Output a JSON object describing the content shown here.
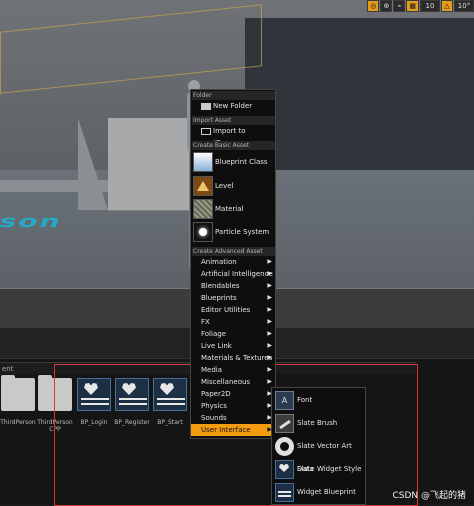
{
  "viewport": {
    "floor_text": "son",
    "toolbar": [
      {
        "icon": "snap-icon",
        "label": "◎",
        "active": true
      },
      {
        "icon": "globe-icon",
        "label": "⊕",
        "active": false
      },
      {
        "icon": "surface-snap-icon",
        "label": "⌁",
        "active": false
      },
      {
        "icon": "grid-snap-icon",
        "label": "▦",
        "active": true
      },
      {
        "icon": "grid-size",
        "label": "10",
        "active": false
      },
      {
        "icon": "rotation-snap-icon",
        "label": "△",
        "active": true
      },
      {
        "icon": "rotation-size",
        "label": "10°",
        "active": false
      }
    ]
  },
  "context_menu": {
    "sections": {
      "folder": "Folder",
      "import": "Import Asset",
      "basic": "Create Basic Asset",
      "advanced": "Create Advanced Asset"
    },
    "new_folder": "New Folder",
    "import_to": "Import to /Game...",
    "basic_items": [
      "Blueprint Class",
      "Level",
      "Material",
      "Particle System"
    ],
    "advanced_items": [
      "Animation",
      "Artificial Intelligence",
      "Blendables",
      "Blueprints",
      "Editor Utilities",
      "FX",
      "Foliage",
      "Live Link",
      "Materials & Textures",
      "Media",
      "Miscellaneous",
      "Paper2D",
      "Physics",
      "Sounds",
      "User Interface"
    ],
    "highlighted": "User Interface"
  },
  "submenu": {
    "items": [
      "Font",
      "Slate Brush",
      "Slate Vector Art Data",
      "Slate Widget Style",
      "Widget Blueprint"
    ]
  },
  "content_browser": {
    "path_label": "ent",
    "assets": [
      {
        "name": "ThirdPerson",
        "kind": "folder"
      },
      {
        "name": "ThirdPerson\nCPP",
        "kind": "folder"
      },
      {
        "name": "BP_Login",
        "kind": "blueprint"
      },
      {
        "name": "BP_Register",
        "kind": "blueprint"
      },
      {
        "name": "BP_Start",
        "kind": "blueprint"
      }
    ]
  },
  "watermark": "CSDN @飞起的猪",
  "colors": {
    "highlight": "#f39c12",
    "accent_red": "#d23a3a",
    "toolbar_active": "#e29d19"
  }
}
